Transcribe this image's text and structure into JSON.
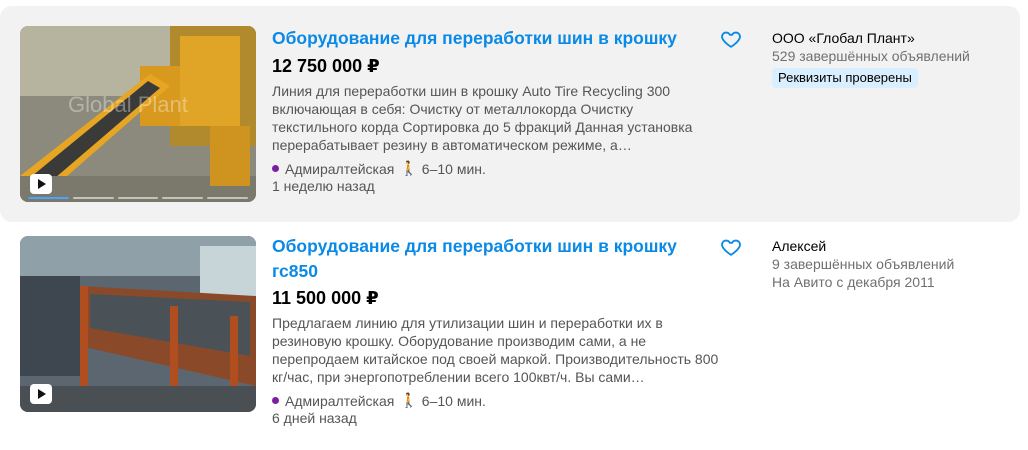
{
  "listings": [
    {
      "title": "Оборудование для переработки шин в крошку",
      "price": "12 750 000 ₽",
      "description": "Линия для переработки шин в крошку Auto Tire Recycling 300 включающая в себя: Очистку от металлокорда Очистку текстильного корда Сортировка до 5 фракций Данная установка перерабатывает резину в автоматическом режиме, а…",
      "metro_station": "Адмиралтейская",
      "walk_time": "6–10 мин.",
      "posted": "1 неделю назад",
      "seller_name": "ООО «Глобал Плант»",
      "seller_stats": "529 завершённых объявлений",
      "seller_badge": "Реквизиты проверены",
      "photo_watermark": "Global Plant",
      "metro_color": "#7a1fa2"
    },
    {
      "title": "Оборудование для переработки шин в крошку гс850",
      "price": "11 500 000 ₽",
      "description": "Предлагаем линию для утилизации шин и переработки их в резиновую крошку. Оборудование производим сами, а не перепродаем китайское под своей маркой. Производительность 800 кг/час, при энергопотреблении всего 100квт/ч. Вы сами…",
      "metro_station": "Адмиралтейская",
      "walk_time": "6–10 мин.",
      "posted": "6 дней назад",
      "seller_name": "Алексей",
      "seller_stats": "9 завершённых объявлений",
      "seller_since": "На Авито с декабря 2011",
      "metro_color": "#7a1fa2"
    }
  ],
  "icons": {
    "favorite": "heart-outline-icon",
    "play": "play-icon",
    "walk": "walking-person-icon"
  },
  "colors": {
    "title_link": "#0a8ae6",
    "highlight_background": "#f2f2f2",
    "badge_background": "#d9eefe",
    "heart": "#0a8ae6"
  }
}
